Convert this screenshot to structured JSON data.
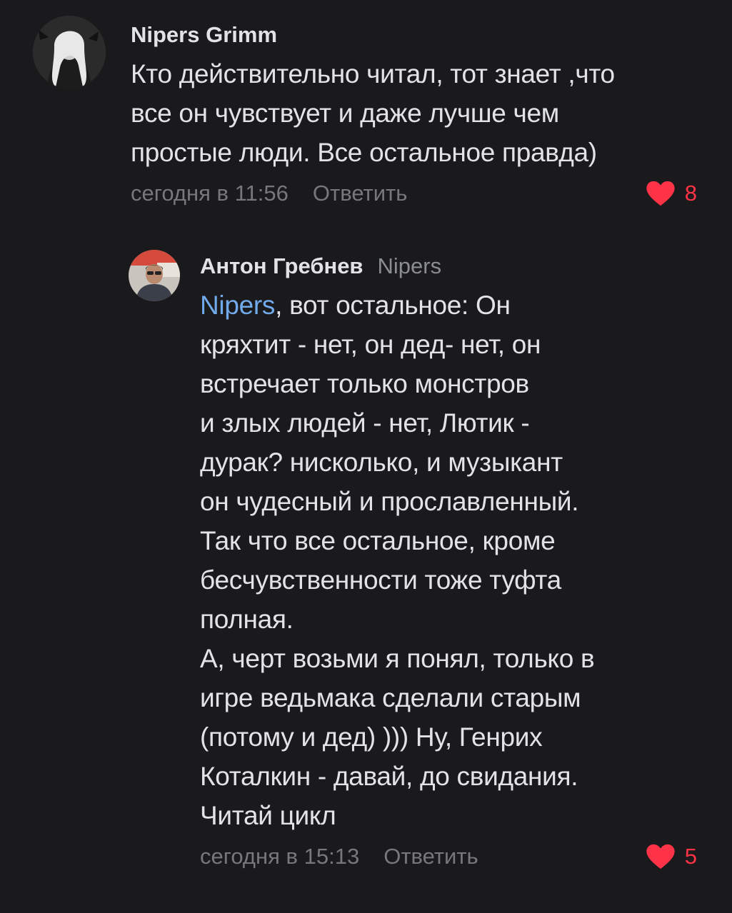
{
  "colors": {
    "background": "#1a191b",
    "text": "#e1e3e6",
    "secondary": "#76787a",
    "mention": "#71aaeb",
    "like": "#ff3347"
  },
  "comments": [
    {
      "author": "Nipers Grimm",
      "text": "Кто действительно читал, тот знает ,что\nвсе он чувствует и даже лучше чем\nпростые люди. Все остальное правда)",
      "time": "сегодня в 11:56",
      "reply_label": "Ответить",
      "likes": "8",
      "avatar_icon": "user-photo-icon"
    },
    {
      "author": "Антон Гребнев",
      "reply_to": "Nipers",
      "mention": "Nipers",
      "text": ", вот остальное: Он\nкряхтит - нет, он дед- нет, он\nвстречает только монстров\nи злых людей - нет, Лютик -\nдурак? нисколько, и музыкант\nон чудесный и прославленный.\nТак что все остальное, кроме\nбесчувственности тоже туфта\nполная.\nА, черт возьми я понял, только в\nигре ведьмака сделали старым\n(потому и дед) ))) Ну, Генрих\nКоталкин - давай, до свидания.\nЧитай цикл",
      "time": "сегодня в 15:13",
      "reply_label": "Ответить",
      "likes": "5",
      "avatar_icon": "user-photo-icon"
    }
  ]
}
